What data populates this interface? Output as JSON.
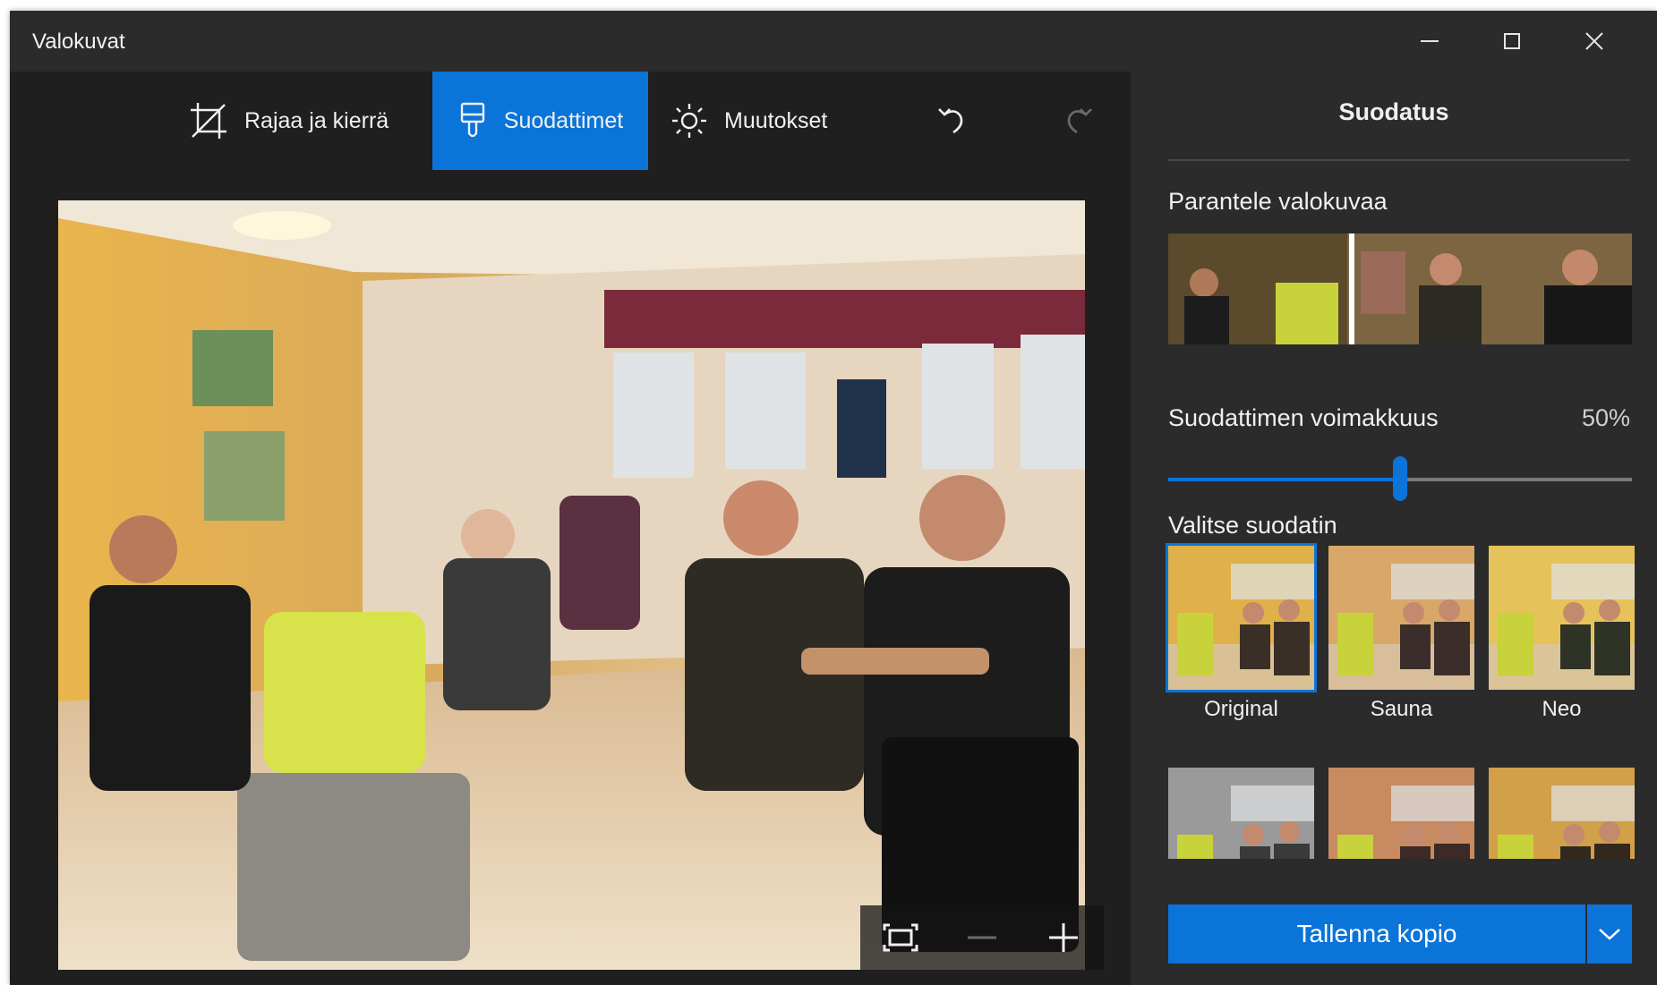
{
  "window": {
    "title": "Valokuvat"
  },
  "toolbar": {
    "crop_label": "Rajaa ja kierrä",
    "filters_label": "Suodattimet",
    "adjust_label": "Muutokset"
  },
  "panel": {
    "title": "Suodatus",
    "enhance_label": "Parantele valokuvaa",
    "strength_label": "Suodattimen voimakkuus",
    "strength_value": "50%",
    "strength_fraction": 0.5,
    "choose_label": "Valitse suodatin",
    "filters": [
      {
        "label": "Original",
        "selected": true
      },
      {
        "label": "Sauna",
        "selected": false
      },
      {
        "label": "Neo",
        "selected": false
      },
      {
        "label": "",
        "selected": false
      },
      {
        "label": "",
        "selected": false
      },
      {
        "label": "",
        "selected": false
      }
    ],
    "save_label": "Tallenna kopio"
  },
  "colors": {
    "accent": "#0a74d8",
    "panel_bg": "#2b2b2b",
    "editor_bg": "#1f1f1f"
  }
}
